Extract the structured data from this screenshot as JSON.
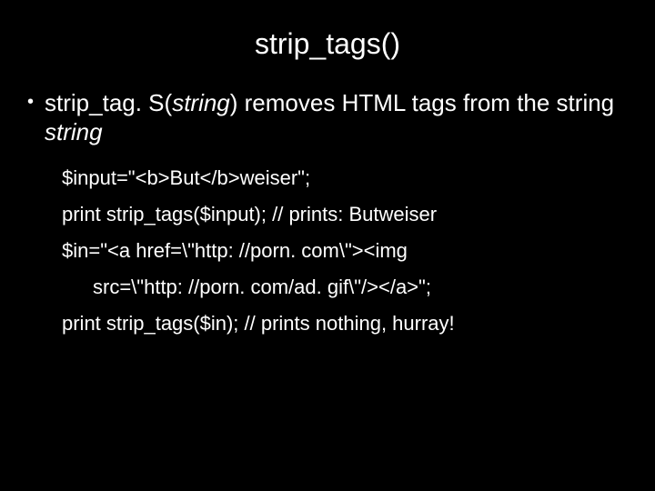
{
  "title": "strip_tags()",
  "bullet": {
    "part1": "strip_tag. S(",
    "part2_italic": "string",
    "part3": ") removes HTML tags from the string ",
    "part4_italic": "string"
  },
  "code": {
    "line1": "$input=\"<b>But</b>weiser\";",
    "line2": "print strip_tags($input);      // prints: Butweiser",
    "line3": "$in=\"<a  href=\\\"http: //porn. com\\\"><img",
    "line3b": "src=\\\"http: //porn. com/ad. gif\\\"/></a>\";",
    "line4": "print strip_tags($in);            // prints nothing, hurray!"
  }
}
